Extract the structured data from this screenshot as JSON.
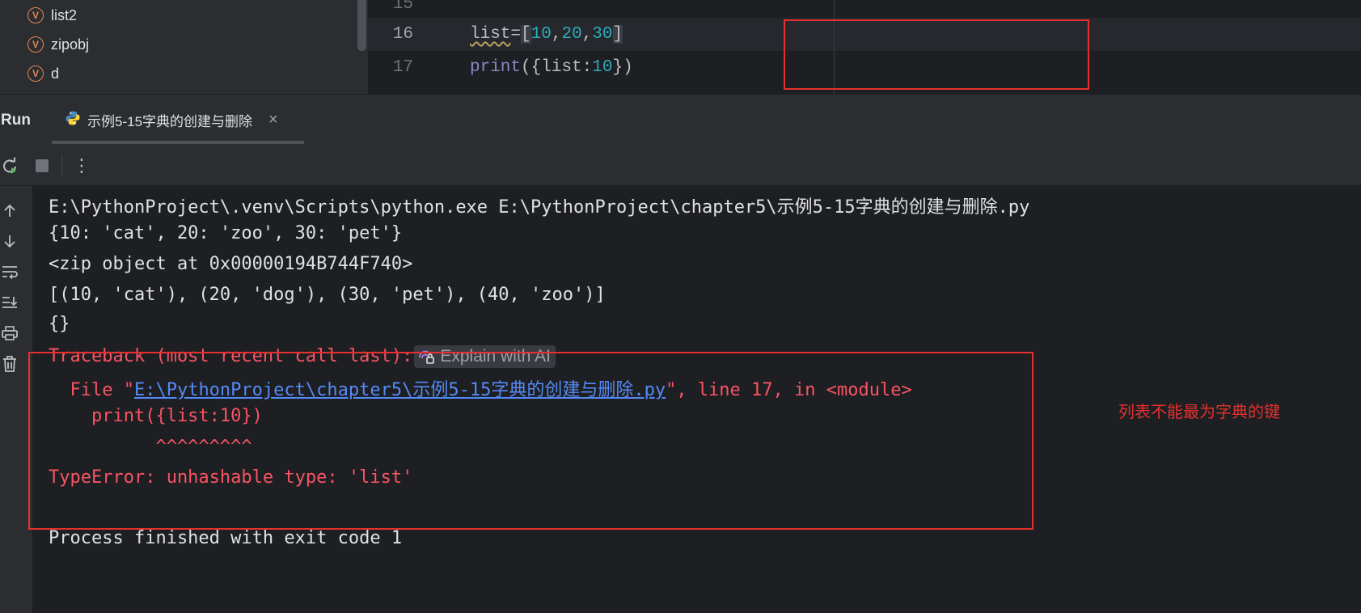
{
  "structure": {
    "items": [
      {
        "badge": "V",
        "label": "list2"
      },
      {
        "badge": "V",
        "label": "zipobj"
      },
      {
        "badge": "V",
        "label": "d"
      }
    ]
  },
  "editor": {
    "lines": [
      {
        "num": "15"
      },
      {
        "num": "16",
        "tokens": [
          "list",
          "=",
          "[",
          "10",
          ",",
          "20",
          ",",
          "30",
          "]"
        ]
      },
      {
        "num": "17",
        "tokens": [
          "print",
          "({",
          "list",
          ":",
          "10",
          "})"
        ]
      }
    ]
  },
  "run_window": {
    "title": "Run",
    "tab_label": "示例5-15字典的创建与删除",
    "tab_close": "×",
    "toolbar_more": "⋮"
  },
  "console": {
    "cmd": "E:\\PythonProject\\.venv\\Scripts\\python.exe E:\\PythonProject\\chapter5\\示例5-15字典的创建与删除.py",
    "out1": "{10: 'cat', 20: 'zoo', 30: 'pet'}",
    "out2": "<zip object at 0x00000194B744F740>",
    "out3": "[(10, 'cat'), (20, 'dog'), (30, 'pet'), (40, 'zoo')]",
    "out4": "{}",
    "traceback": "Traceback (most recent call last):",
    "explain_ai": "Explain with AI",
    "file_prefix": "  File \"",
    "file_link": "E:\\PythonProject\\chapter5\\示例5-15字典的创建与删除.py",
    "file_suffix": "\", line 17, in <module>",
    "code_echo": "    print({list:10})",
    "carets": "          ^^^^^^^^^",
    "error": "TypeError: unhashable type: 'list'",
    "exit": "Process finished with exit code 1"
  },
  "annotation": "列表不能最为字典的键",
  "colors": {
    "highlight_box": "#e5302f",
    "error_text": "#f75464",
    "link": "#548af7",
    "number": "#2aacb8"
  }
}
